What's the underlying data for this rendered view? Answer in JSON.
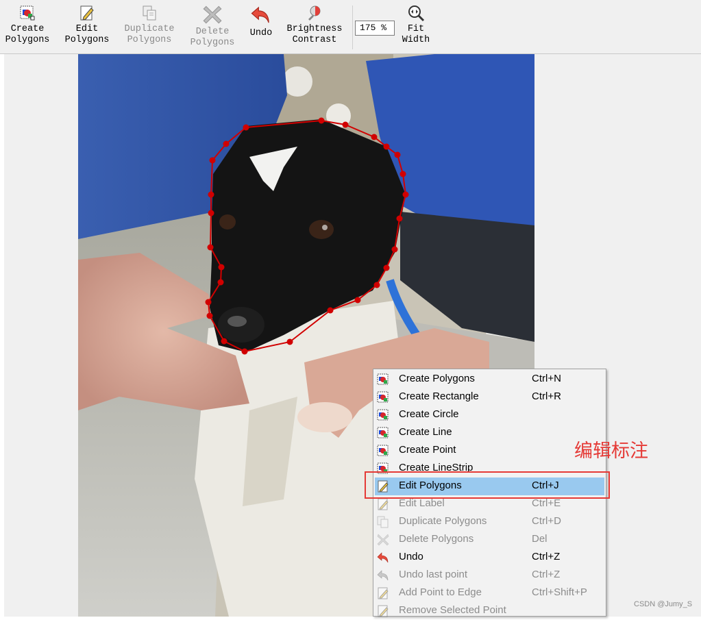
{
  "toolbar": {
    "create_polygons": "Create\nPolygons",
    "edit_polygons": "Edit\nPolygons",
    "duplicate_polygons": "Duplicate\nPolygons",
    "delete_polygons": "Delete\nPolygons",
    "undo": "Undo",
    "brightness_contrast": "Brightness\nContrast",
    "zoom_value": "175 %",
    "fit_width": "Fit\nWidth"
  },
  "menu": {
    "items": [
      {
        "label": "Create Polygons",
        "shortcut": "Ctrl+N",
        "icon": "create-polygon-icon",
        "enabled": true
      },
      {
        "label": "Create Rectangle",
        "shortcut": "Ctrl+R",
        "icon": "create-polygon-icon",
        "enabled": true
      },
      {
        "label": "Create Circle",
        "shortcut": "",
        "icon": "create-polygon-icon",
        "enabled": true
      },
      {
        "label": "Create Line",
        "shortcut": "",
        "icon": "create-polygon-icon",
        "enabled": true
      },
      {
        "label": "Create Point",
        "shortcut": "",
        "icon": "create-polygon-icon",
        "enabled": true
      },
      {
        "label": "Create LineStrip",
        "shortcut": "",
        "icon": "create-polygon-icon",
        "enabled": true
      },
      {
        "label": "Edit Polygons",
        "shortcut": "Ctrl+J",
        "icon": "edit-icon",
        "enabled": true,
        "selected": true
      },
      {
        "label": "Edit Label",
        "shortcut": "Ctrl+E",
        "icon": "edit-icon",
        "enabled": false
      },
      {
        "label": "Duplicate Polygons",
        "shortcut": "Ctrl+D",
        "icon": "duplicate-icon",
        "enabled": false
      },
      {
        "label": "Delete Polygons",
        "shortcut": "Del",
        "icon": "delete-icon",
        "enabled": false
      },
      {
        "label": "Undo",
        "shortcut": "Ctrl+Z",
        "icon": "undo-icon",
        "enabled": true
      },
      {
        "label": "Undo last point",
        "shortcut": "Ctrl+Z",
        "icon": "undo-icon",
        "enabled": false
      },
      {
        "label": "Add Point to Edge",
        "shortcut": "Ctrl+Shift+P",
        "icon": "edit-icon",
        "enabled": false
      },
      {
        "label": "Remove Selected Point",
        "shortcut": "",
        "icon": "edit-icon",
        "enabled": false
      }
    ]
  },
  "annotation": {
    "text": "编辑标注",
    "color": "#e53935"
  },
  "watermark": "CSDN @Jumy_S",
  "colors": {
    "polygon": "#d10000",
    "selection": "#99c9ef",
    "toolbar_bg": "#f0f0f0"
  }
}
